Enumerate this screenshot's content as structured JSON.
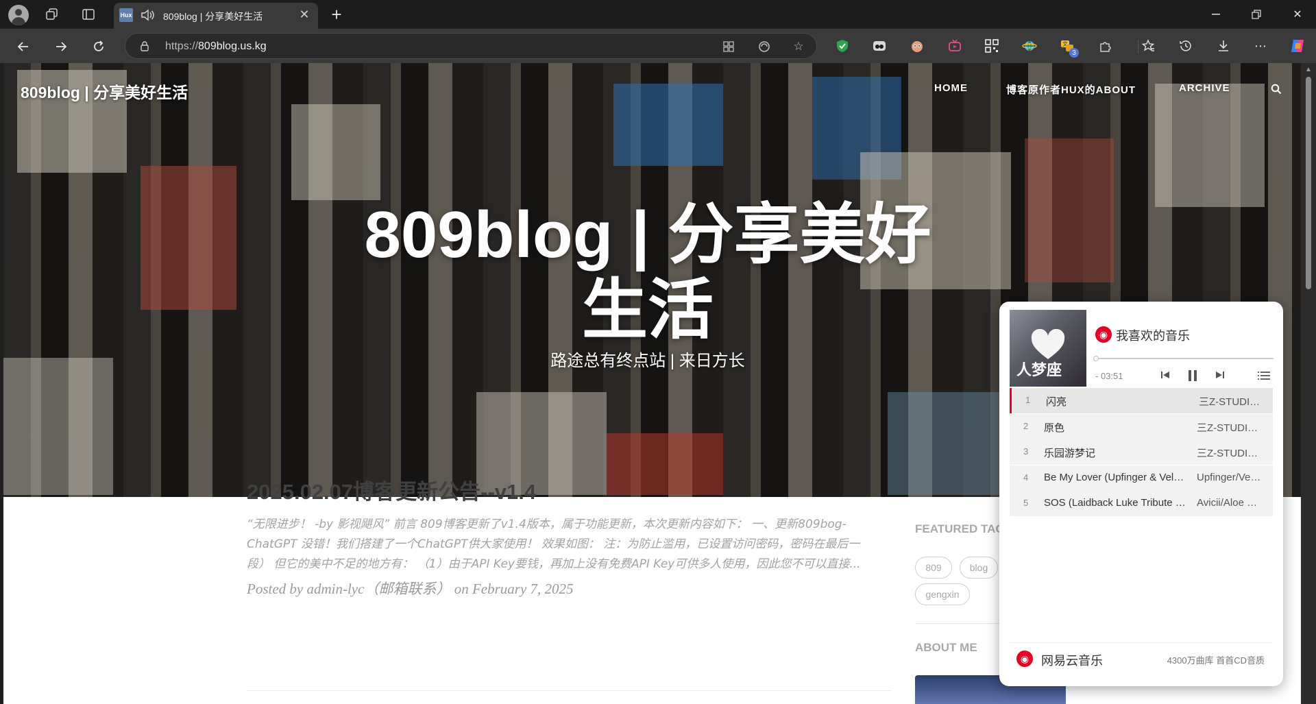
{
  "browser": {
    "tab": {
      "favicon_text": "Hux",
      "title": "809blog | 分享美好生活"
    },
    "url": {
      "prefix": "https://",
      "host": "809blog.us.kg"
    },
    "extensions": [
      {
        "name": "shield-check-icon",
        "color": "#2da44e"
      },
      {
        "name": "eyes-icon",
        "color": "#cfcfcf"
      },
      {
        "name": "monkey-icon",
        "color": "#e8a07a"
      },
      {
        "name": "tv-icon",
        "color": "#e04f8e"
      },
      {
        "name": "qr-code-icon",
        "color": "#f0f0f0"
      },
      {
        "name": "globe-icon",
        "color": "#56b4e9"
      },
      {
        "name": "translate-icon",
        "color": "#f2c230",
        "badge": "3"
      },
      {
        "name": "puzzle-icon",
        "color": "#d0d0d0"
      }
    ]
  },
  "site": {
    "brand": "809blog | 分享美好生活",
    "nav": [
      "HOME",
      "博客原作者HUX的ABOUT",
      "ARCHIVE"
    ],
    "hero_title_line1": "809blog | 分享美好",
    "hero_title_line2": "生活",
    "hero_subtitle": "路途总有终点站 | 来日方长"
  },
  "post": {
    "title": "2025.02.07博客更新公告--v1.4",
    "excerpt": "“无限进步！ -by 影视飓风” 前言 809博客更新了v1.4版本，属于功能更新，本次更新内容如下： 一、更新809bog-ChatGPT 没错！我们搭建了一个ChatGPT供大家使用！ 效果如图： 注：为防止滥用，已设置访问密码，密码在最后一段） 但它的美中不足的地方有： （1）由于API Key要钱，再加上没有免费API Key可供多人使用，因此您不可以直接...",
    "meta": "Posted by admin-lyc（邮箱联系） on February 7, 2025"
  },
  "sidebar": {
    "featured_tags_heading": "FEATURED TAGS",
    "tags": [
      "809",
      "blog",
      "gengxin"
    ],
    "about_heading": "ABOUT ME"
  },
  "player": {
    "cover_text": "人梦座",
    "playlist_name": "我喜欢的音乐",
    "progress": 0,
    "time": "- 03:51",
    "tracks": [
      {
        "idx": "1",
        "name": "闪亮",
        "artist": "三Z-STUDIO/HOYO-MiX"
      },
      {
        "idx": "2",
        "name": "原色",
        "artist": "三Z-STUDIO/HOYO-MiX"
      },
      {
        "idx": "3",
        "name": "乐园游梦记",
        "artist": "三Z-STUDIO/HOYO-MiX"
      },
      {
        "idx": "4",
        "name": "Be My Lover (Upfinger & Velvet Remix)",
        "artist": "Upfinger/Velvet"
      },
      {
        "idx": "5",
        "name": "SOS (Laidback Luke Tribute Remix)",
        "artist": "Avicii/Aloe Blacc"
      }
    ],
    "footer_brand": "网易云音乐",
    "footer_note": "4300万曲库 首首CD音质",
    "accent": "#e60026"
  }
}
